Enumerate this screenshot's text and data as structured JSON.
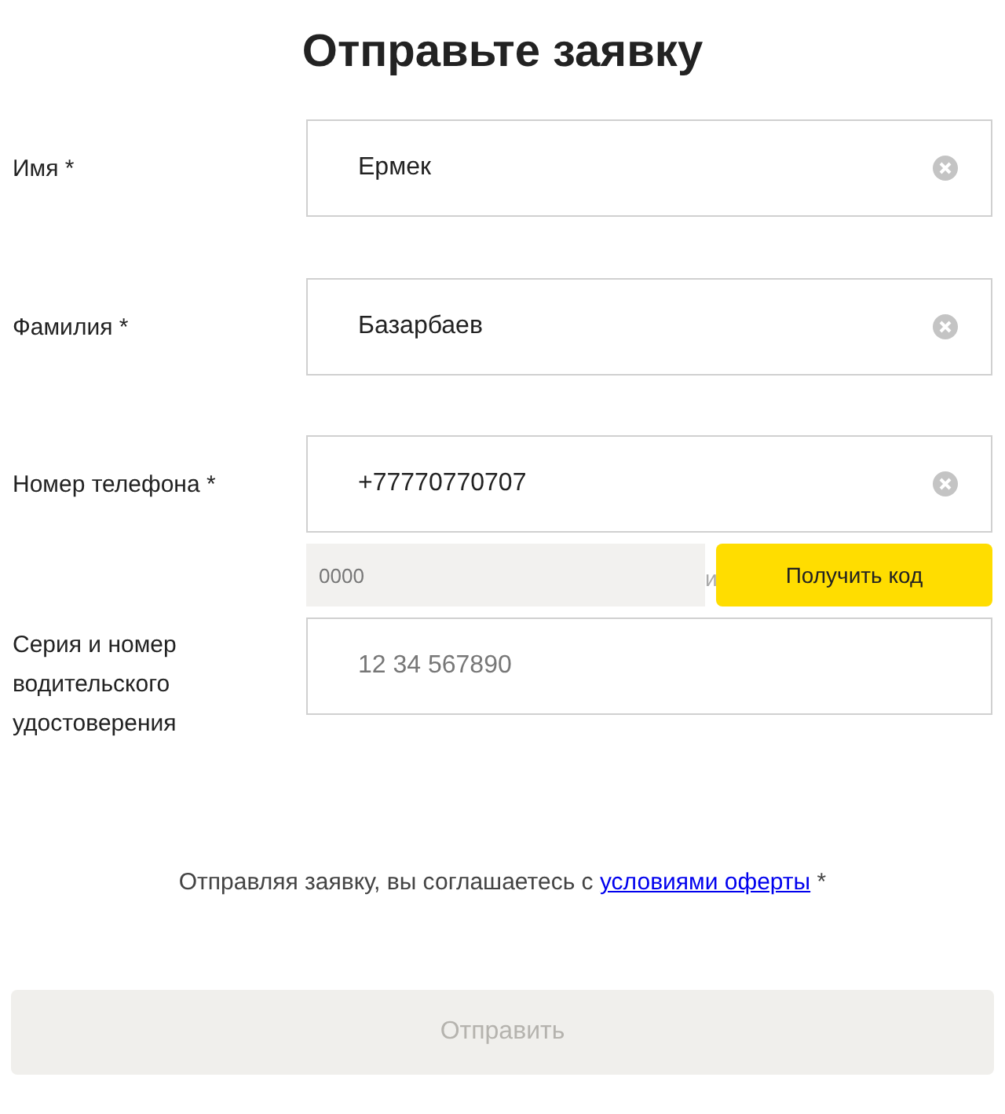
{
  "title": "Отправьте заявку",
  "fields": [
    {
      "label": "Имя *",
      "value": "Ермек",
      "clearable": true
    },
    {
      "label": "Фамилия *",
      "value": "Базарбаев",
      "clearable": true
    },
    {
      "label": "Номер телефона *",
      "value": "+77770770707",
      "clearable": true,
      "code": {
        "placeholder": "0000",
        "hint": "и",
        "button": "Получить код"
      }
    },
    {
      "label": "Серия и номер водительского удостоверения",
      "placeholder": "12 34 567890",
      "clearable": false
    }
  ],
  "agreement": {
    "text": "Отправляя заявку, вы соглашаетесь с",
    "link": "условиями оферты",
    "mark": "*"
  },
  "submit": {
    "label": "Отправить",
    "disabled": true
  }
}
